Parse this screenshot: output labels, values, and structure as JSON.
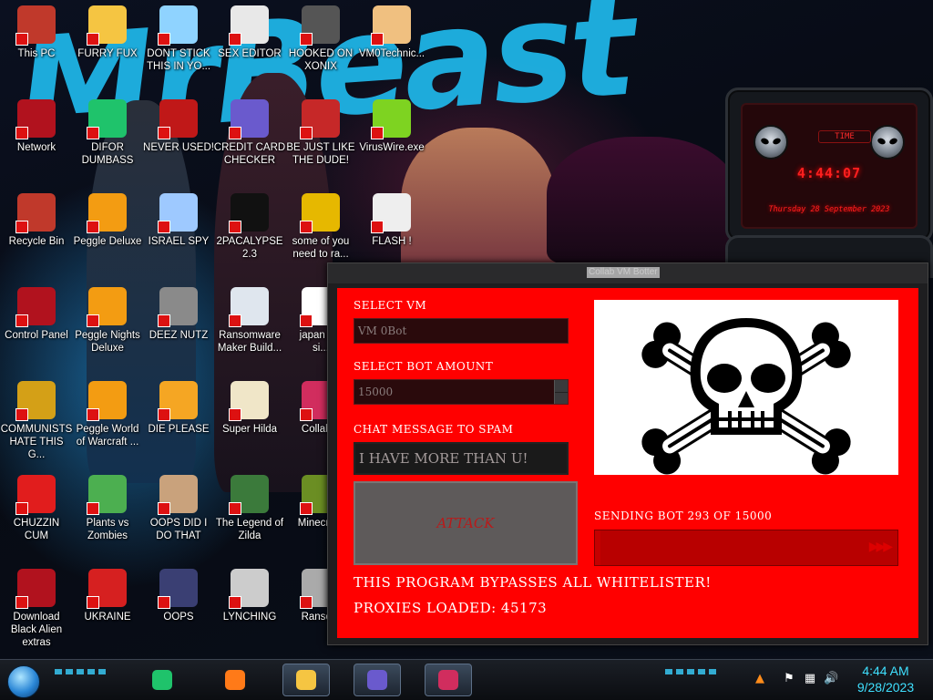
{
  "desktop": {
    "icons": [
      {
        "label": "This PC",
        "icon": "computer-icon",
        "color": "#c0392b"
      },
      {
        "label": "FURRY FUX",
        "icon": "cartoon-icon",
        "color": "#f5c542"
      },
      {
        "label": "DONT STICK\nTHIS IN YO...",
        "icon": "cartoon-face-icon",
        "color": "#8fd3ff"
      },
      {
        "label": "SEX EDITOR",
        "icon": "hex-editor-icon",
        "color": "#e8e8e8"
      },
      {
        "label": "HOOKED ON\nXONIX",
        "icon": "game-icon",
        "color": "#555555"
      },
      {
        "label": "VM0Technic...",
        "icon": "doctor-icon",
        "color": "#f0c080"
      },
      {
        "label": "Network",
        "icon": "alien-network-icon",
        "color": "#b1121e"
      },
      {
        "label": "DIFOR\nDUMBASS",
        "icon": "chat-app-icon",
        "color": "#1fc36b"
      },
      {
        "label": "NEVER USED!",
        "icon": "dev-cpp-icon",
        "color": "#c01818"
      },
      {
        "label": "CREDIT CARD\nCHECKER",
        "icon": "credit-card-icon",
        "color": "#6a5acd"
      },
      {
        "label": "BE JUST LIKE\nTHE DUDE!",
        "icon": "santa-icon",
        "color": "#c62828"
      },
      {
        "label": "VirusWire.exe",
        "icon": "lime-icon",
        "color": "#7ed321"
      },
      {
        "label": "Recycle Bin",
        "icon": "recycle-bin-icon",
        "color": "#c0392b"
      },
      {
        "label": "Peggle Deluxe",
        "icon": "peggle-icon",
        "color": "#f39c12"
      },
      {
        "label": "ISRAEL SPY",
        "icon": "spy-icon",
        "color": "#9ec9ff"
      },
      {
        "label": "2PACALYPSE\n2.3",
        "icon": "terminal-icon",
        "color": "#111111"
      },
      {
        "label": "some of you\nneed to ra...",
        "icon": "beaver-icon",
        "color": "#e6b800"
      },
      {
        "label": "FLASH !",
        "icon": "flash-document-icon",
        "color": "#eeeeee"
      },
      {
        "label": "Control Panel",
        "icon": "control-panel-icon",
        "color": "#b1121e"
      },
      {
        "label": "Peggle Nights\nDeluxe",
        "icon": "peggle-nights-icon",
        "color": "#f39c12"
      },
      {
        "label": "DEEZ NUTZ",
        "icon": "windows-stack-icon",
        "color": "#8a8a8a"
      },
      {
        "label": "Ransomware\nMaker Build...",
        "icon": "window-app-icon",
        "color": "#dfe6ee"
      },
      {
        "label": "japan s...\nsi...",
        "icon": "document-icon",
        "color": "#ffffff"
      },
      {
        "label": "COMMUNISTS\nHATE THIS G...",
        "icon": "money-bag-icon",
        "color": "#d4a017"
      },
      {
        "label": "Peggle World\nof Warcraft ...",
        "icon": "peggle-wow-icon",
        "color": "#f39c12"
      },
      {
        "label": "DIE PLEASE",
        "icon": "de-icon",
        "color": "#f5a623"
      },
      {
        "label": "Super Hilda",
        "icon": "pixel-art-icon",
        "color": "#f0e6c8"
      },
      {
        "label": "Collab...",
        "icon": "collab-icon",
        "color": "#d12d5e"
      },
      {
        "label": "CHUZZIN\nCUM",
        "icon": "chuzzle-icon",
        "color": "#e11d1d"
      },
      {
        "label": "Plants vs\nZombies",
        "icon": "plant-icon",
        "color": "#4caf50"
      },
      {
        "label": "OOPS DID I\nDO THAT",
        "icon": "portrait-icon",
        "color": "#c9a27c"
      },
      {
        "label": "The Legend of\nZilda",
        "icon": "zelda-icon",
        "color": "#3b7a3b"
      },
      {
        "label": "Minecra...",
        "icon": "minecraft-icon",
        "color": "#6b8e23"
      },
      {
        "label": "Download\nBlack Alien\nextras",
        "icon": "alien-download-icon",
        "color": "#b1121e"
      },
      {
        "label": "UKRAINE",
        "icon": "radiation-icon",
        "color": "#d62020"
      },
      {
        "label": "OOPS",
        "icon": "app-icon",
        "color": "#3a3f73"
      },
      {
        "label": "LYNCHING",
        "icon": "network-tool-icon",
        "color": "#cccccc"
      },
      {
        "label": "Ranso...",
        "icon": "ransom-icon",
        "color": "#aaaaaa"
      }
    ]
  },
  "wallpaper": {
    "text": "MrBeast"
  },
  "gadget": {
    "time_label": "TIME",
    "time": "4:44:07",
    "date": "Thursday 28 September 2023"
  },
  "window": {
    "title": "Collab VM Botter",
    "select_vm_label": "SELECT VM",
    "select_vm_value": "VM 0Bot",
    "bot_amount_label": "SELECT BOT AMOUNT",
    "bot_amount_value": "15000",
    "chat_label": "CHAT MESSAGE TO SPAM",
    "chat_value": "I HAVE MORE THAN U!",
    "attack_button": "ATTACK",
    "status": "SENDING BOT 293 OF 15000",
    "progress": {
      "current": 293,
      "total": 15000
    },
    "notice1": "THIS PROGRAM BYPASSES ALL WHITELISTER!",
    "notice2": "PROXIES LOADED: 45173"
  },
  "taskbar": {
    "items": [
      {
        "name": "taskbar-chat-app",
        "icon": "chat-app-icon",
        "color": "#1fc36b",
        "active": false
      },
      {
        "name": "taskbar-firefox",
        "icon": "firefox-icon",
        "color": "#ff7a18",
        "active": false
      },
      {
        "name": "taskbar-file-explorer",
        "icon": "folder-icon",
        "color": "#f5c542",
        "active": true
      },
      {
        "name": "taskbar-credit-card-checker",
        "icon": "credit-card-icon",
        "color": "#6a5acd",
        "active": true
      },
      {
        "name": "taskbar-collab-vm",
        "icon": "collab-icon",
        "color": "#d12d5e",
        "active": true
      }
    ],
    "time": "4:44 AM",
    "date": "9/28/2023"
  }
}
